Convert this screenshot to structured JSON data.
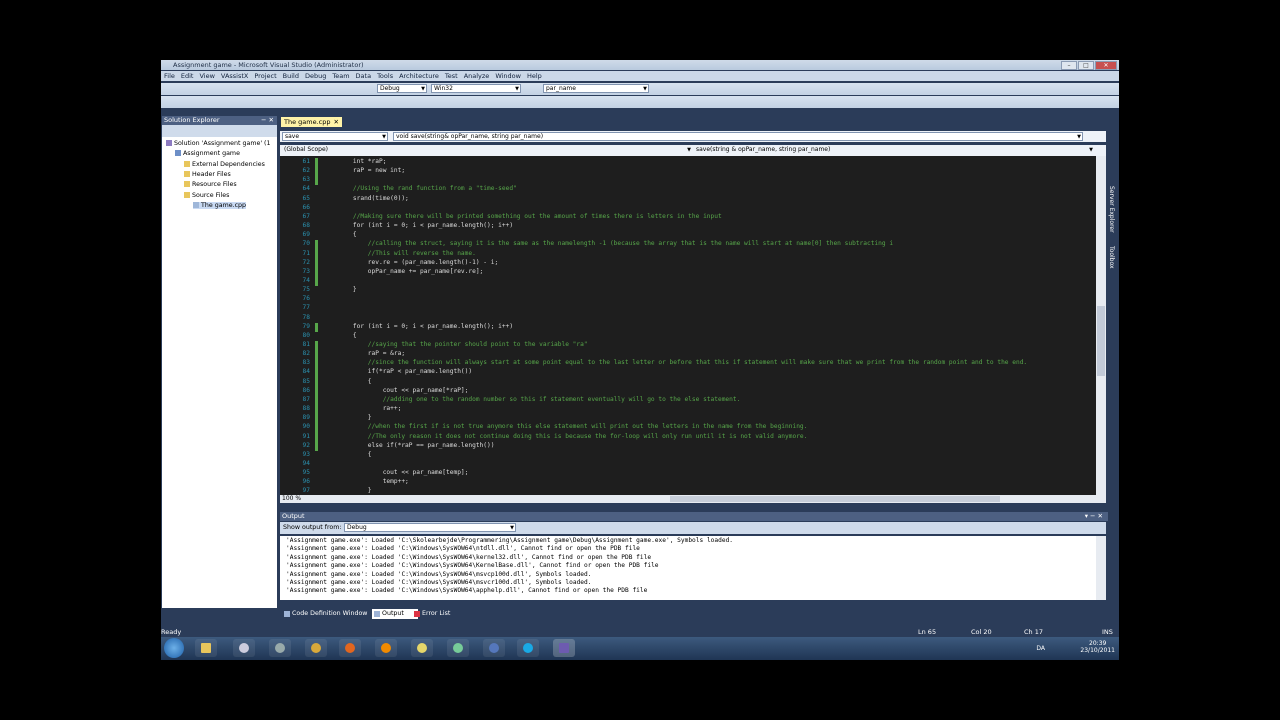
{
  "window": {
    "title": "Assignment game - Microsoft Visual Studio (Administrator)"
  },
  "menu": [
    "File",
    "Edit",
    "View",
    "VAssistX",
    "Project",
    "Build",
    "Debug",
    "Team",
    "Data",
    "Tools",
    "Architecture",
    "Test",
    "Analyze",
    "Window",
    "Help"
  ],
  "toolbar": {
    "config": "Debug",
    "platform": "Win32",
    "find": "par_name"
  },
  "solution_explorer": {
    "title": "Solution Explorer",
    "items": [
      {
        "label": "Solution 'Assignment game' (1",
        "indent": 0,
        "icon": "sol"
      },
      {
        "label": "Assignment game",
        "indent": 1,
        "icon": "prj"
      },
      {
        "label": "External Dependencies",
        "indent": 2,
        "icon": "fld"
      },
      {
        "label": "Header Files",
        "indent": 2,
        "icon": "fld"
      },
      {
        "label": "Resource Files",
        "indent": 2,
        "icon": "fld"
      },
      {
        "label": "Source Files",
        "indent": 2,
        "icon": "fld"
      },
      {
        "label": "The game.cpp",
        "indent": 3,
        "icon": "file"
      }
    ]
  },
  "editor": {
    "tab": "The game.cpp",
    "nav_left": "save",
    "nav_function": "void save(string& opPar_name, string par_name)",
    "scope": "(Global Scope)",
    "member": "save(string & opPar_name, string par_name)",
    "zoom": "100 %",
    "lines": [
      {
        "n": "61",
        "t": "    int *raP;"
      },
      {
        "n": "62",
        "t": "    raP = new int;"
      },
      {
        "n": "63",
        "t": ""
      },
      {
        "n": "64",
        "t": "    //Using the rand function from a \"time-seed\"",
        "c": "cm"
      },
      {
        "n": "65",
        "t": "    srand(time(0));"
      },
      {
        "n": "66",
        "t": ""
      },
      {
        "n": "67",
        "t": "    //Making sure there will be printed something out the amount of times there is letters in the input",
        "c": "cm"
      },
      {
        "n": "68",
        "t": "    for (int i = 0; i < par_name.length(); i++)"
      },
      {
        "n": "69",
        "t": "    {"
      },
      {
        "n": "70",
        "t": "        //calling the struct, saying it is the same as the namelength -1 (because the array that is the name will start at name[0] then subtracting i",
        "c": "cm"
      },
      {
        "n": "71",
        "t": "        //This will reverse the name.",
        "c": "cm"
      },
      {
        "n": "72",
        "t": "        rev.re = (par_name.length()-1) - i;"
      },
      {
        "n": "73",
        "t": "        opPar_name += par_name[rev.re];"
      },
      {
        "n": "74",
        "t": ""
      },
      {
        "n": "75",
        "t": "    }"
      },
      {
        "n": "76",
        "t": ""
      },
      {
        "n": "77",
        "t": ""
      },
      {
        "n": "78",
        "t": ""
      },
      {
        "n": "79",
        "t": "    for (int i = 0; i < par_name.length(); i++)"
      },
      {
        "n": "80",
        "t": "    {"
      },
      {
        "n": "81",
        "t": "        //saying that the pointer should point to the variable \"ra\"",
        "c": "cm"
      },
      {
        "n": "82",
        "t": "        raP = &ra;"
      },
      {
        "n": "83",
        "t": "        //since the function will always start at some point equal to the last letter or before that this if statement will make sure that we print from the random point and to the end.",
        "c": "cm"
      },
      {
        "n": "84",
        "t": "        if(*raP < par_name.length())"
      },
      {
        "n": "85",
        "t": "        {"
      },
      {
        "n": "86",
        "t": "            cout << par_name[*raP];"
      },
      {
        "n": "87",
        "t": "            //adding one to the random number so this if statement eventually will go to the else statement.",
        "c": "cm"
      },
      {
        "n": "88",
        "t": "            ra++;"
      },
      {
        "n": "89",
        "t": "        }"
      },
      {
        "n": "90",
        "t": "        //when the first if is not true anymore this else statement will print out the letters in the name from the beginning.",
        "c": "cm"
      },
      {
        "n": "91",
        "t": "        //The only reason it does not continue doing this is because the for-loop will only run until it is not valid anymore.",
        "c": "cm"
      },
      {
        "n": "92",
        "t": "        else if(*raP == par_name.length())"
      },
      {
        "n": "93",
        "t": "        {"
      },
      {
        "n": "94",
        "t": ""
      },
      {
        "n": "95",
        "t": "            cout << par_name[temp];"
      },
      {
        "n": "96",
        "t": "            temp++;"
      },
      {
        "n": "97",
        "t": "        }"
      }
    ]
  },
  "output": {
    "title": "Output",
    "show_from_label": "Show output from:",
    "show_from_value": "Debug",
    "lines": [
      "'Assignment game.exe': Loaded 'C:\\Skolearbejde\\Programmering\\Assignment game\\Debug\\Assignment game.exe', Symbols loaded.",
      "'Assignment game.exe': Loaded 'C:\\Windows\\SysWOW64\\ntdll.dll', Cannot find or open the PDB file",
      "'Assignment game.exe': Loaded 'C:\\Windows\\SysWOW64\\kernel32.dll', Cannot find or open the PDB file",
      "'Assignment game.exe': Loaded 'C:\\Windows\\SysWOW64\\KernelBase.dll', Cannot find or open the PDB file",
      "'Assignment game.exe': Loaded 'C:\\Windows\\SysWOW64\\msvcp100d.dll', Symbols loaded.",
      "'Assignment game.exe': Loaded 'C:\\Windows\\SysWOW64\\msvcr100d.dll', Symbols loaded.",
      "'Assignment game.exe': Loaded 'C:\\Windows\\SysWOW64\\apphelp.dll', Cannot find or open the PDB file"
    ]
  },
  "bottom_tabs": [
    "Code Definition Window",
    "Output",
    "Error List"
  ],
  "status": {
    "ready": "Ready",
    "ln": "Ln 65",
    "col": "Col 20",
    "ch": "Ch 17",
    "ins": "INS"
  },
  "side_tabs": [
    "Server Explorer",
    "Toolbox"
  ],
  "taskbar": {
    "lang": "DA",
    "time": "20:39",
    "date": "23/10/2011"
  }
}
